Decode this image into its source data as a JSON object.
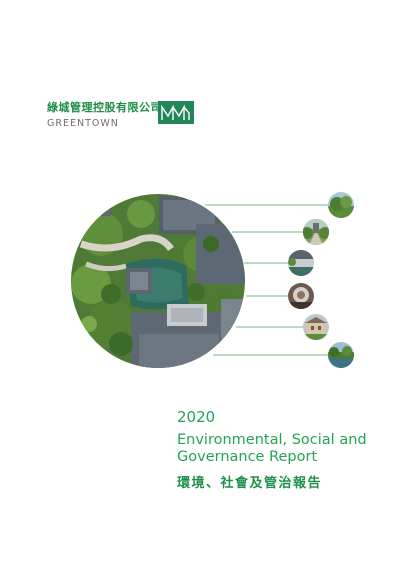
{
  "header": {
    "company_name_cn": "綠城管理控股有限公司",
    "company_name_en": "GREENTOWN"
  },
  "report": {
    "year": "2020",
    "title_en": "Environmental, Social and Governance Report",
    "title_cn": "環境、社會及管治報告"
  },
  "colors": {
    "brand_green": "#1f8e4a",
    "title_green": "#23a455",
    "logo_box": "#23865a"
  },
  "images": {
    "main": "aerial-garden-courtyard",
    "thumbnails": [
      "trees-landscape",
      "garden-path",
      "courtyard-pond",
      "round-lounge-interior",
      "villa-building",
      "waterfront-garden"
    ]
  }
}
